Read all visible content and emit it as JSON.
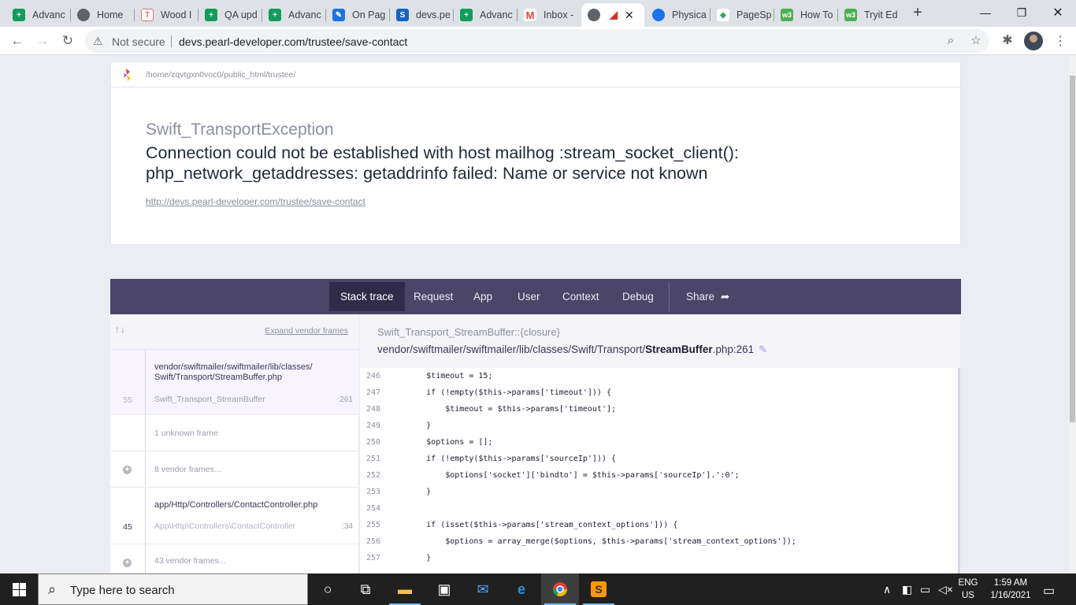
{
  "browser": {
    "tabs": [
      {
        "label": "Advanc",
        "icon": "sheets-icon",
        "color": "#0f9d58"
      },
      {
        "label": "Home",
        "icon": "globe-icon",
        "color": "#5f6368"
      },
      {
        "label": "Wood I",
        "icon": "t-icon",
        "color": "#e57373"
      },
      {
        "label": "QA upd",
        "icon": "sheets-icon",
        "color": "#0f9d58"
      },
      {
        "label": "Advanc",
        "icon": "sheets-icon",
        "color": "#0f9d58"
      },
      {
        "label": "On Pag",
        "icon": "pen-icon",
        "color": "#1a73e8"
      },
      {
        "label": "devs.pe",
        "icon": "s-icon",
        "color": "#1565c0"
      },
      {
        "label": "Advanc",
        "icon": "sheets-icon",
        "color": "#0f9d58"
      },
      {
        "label": "Inbox -",
        "icon": "gmail-icon",
        "color": "#ea4335"
      },
      {
        "label": "",
        "icon": "globe-icon",
        "color": "#5f6368",
        "active": true
      },
      {
        "label": "Physica",
        "icon": "cart-icon",
        "color": "#1a73e8"
      },
      {
        "label": "PageSp",
        "icon": "pagespeed-icon",
        "color": "#34a853"
      },
      {
        "label": "How To",
        "icon": "w3-icon",
        "color": "#4caf50"
      },
      {
        "label": "Tryit Ed",
        "icon": "w3-icon",
        "color": "#4caf50"
      }
    ],
    "new_tab": "+",
    "security_label": "Not secure",
    "url": "devs.pearl-developer.com/trustee/save-contact"
  },
  "ignition": {
    "path": "/home/zqvtgxn0voc0/public_html/trustee/",
    "exception_class": "Swift_TransportException",
    "message": "Connection could not be established with host mailhog :stream_socket_client(): php_network_getaddresses: getaddrinfo failed: Name or service not known",
    "request_url": "http://devs.pearl-developer.com/trustee/save-contact",
    "tabs": [
      "Stack trace",
      "Request",
      "App",
      "User",
      "Context",
      "Debug"
    ],
    "share_label": "Share",
    "expand_vendor": "Expand vendor frames",
    "frames": {
      "f1_path": "vendor/swiftmailer/swiftmailer/lib/classes/ Swift/Transport/",
      "f1_file": "StreamBuffer.php",
      "f1_num": "55",
      "f1_class": "Swift_Transport_StreamBuffer",
      "f1_line": ":261",
      "f2_text": "1 unknown frame",
      "f3_text": "8 vendor frames...",
      "f4_path": "app/Http/Controllers/",
      "f4_file": "ContactController.php",
      "f4_num": "45",
      "f4_class": "App\\Http\\Controllers\\ContactController",
      "f4_line": ":34",
      "f5_text": "43 vendor frames..."
    },
    "detail": {
      "function": "Swift_Transport_StreamBuffer::{closure}",
      "file_dir": "vendor/swiftmailer/swiftmailer/lib/classes/Swift/Transport/",
      "file_name": "StreamBuffer",
      "file_ext": ".php:261"
    },
    "code_lines": [
      {
        "n": "246",
        "t": "        $timeout = 15;"
      },
      {
        "n": "247",
        "t": "        if (!empty($this->params['timeout'])) {"
      },
      {
        "n": "248",
        "t": "            $timeout = $this->params['timeout'];"
      },
      {
        "n": "249",
        "t": "        }"
      },
      {
        "n": "250",
        "t": "        $options = [];"
      },
      {
        "n": "251",
        "t": "        if (!empty($this->params['sourceIp'])) {"
      },
      {
        "n": "252",
        "t": "            $options['socket']['bindto'] = $this->params['sourceIp'].':0';"
      },
      {
        "n": "253",
        "t": "        }"
      },
      {
        "n": "254",
        "t": ""
      },
      {
        "n": "255",
        "t": "        if (isset($this->params['stream_context_options'])) {"
      },
      {
        "n": "256",
        "t": "            $options = array_merge($options, $this->params['stream_context_options']);"
      },
      {
        "n": "257",
        "t": "        }"
      }
    ]
  },
  "taskbar": {
    "search_placeholder": "Type here to search",
    "lang_top": "ENG",
    "lang_bottom": "US",
    "time": "1:59 AM",
    "date": "1/16/2021"
  }
}
